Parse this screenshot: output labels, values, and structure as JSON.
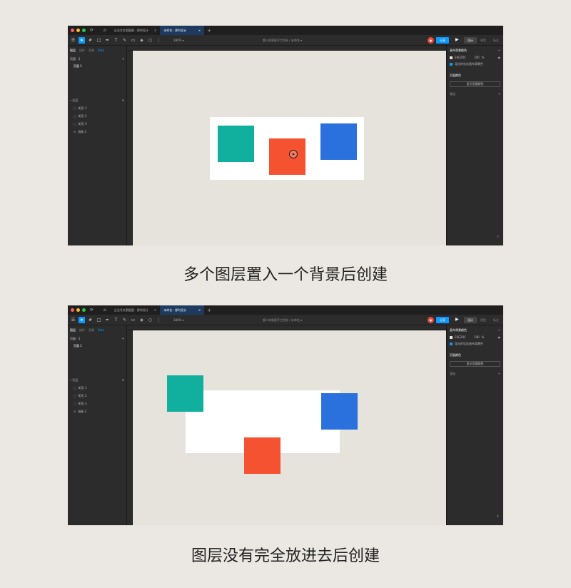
{
  "colors": {
    "teal": "#11b09e",
    "red": "#f55232",
    "blue": "#2a71de",
    "accent": "#0d99ff"
  },
  "editor": {
    "home_icon": "home-icon",
    "tab1_label": "企业号文案配图 - 即时设计",
    "tab2_label": "未命名 - 即时设计",
    "tab_close": "×",
    "tab_add": "+",
    "zoom": "180% ▾",
    "breadcrumb": "超人的收获手工作社 / 未命名 ▾",
    "share_label": "分享",
    "modes": [
      "设计",
      "原型",
      "标注"
    ],
    "left_tabs": [
      "图层",
      "组件",
      "资源"
    ],
    "left_badge": "Beta",
    "page_header": "页面 · 1",
    "page_add": "+",
    "page_item": "页面 1",
    "layers_header": "图层",
    "layers": [
      {
        "icon": "□",
        "name": "矩形 1"
      },
      {
        "icon": "□",
        "name": "矩形 2"
      },
      {
        "icon": "□",
        "name": "矩形 3"
      },
      {
        "icon": "⊞",
        "name": "画板 2"
      }
    ],
    "right_title": "画布背景颜色",
    "bg_hex": "E6E2DC",
    "bg_opacity": "100",
    "bg_pct": "%",
    "export_checkbox": "导出时包含画布背景色",
    "page_color_title": "页面颜色",
    "page_color_button": "显示页面颜色",
    "export_title": "导出",
    "export_add": "+",
    "help": "?"
  },
  "captions": {
    "first": "多个图层置入一个背景后创建",
    "second": "图层没有完全放进去后创建"
  }
}
